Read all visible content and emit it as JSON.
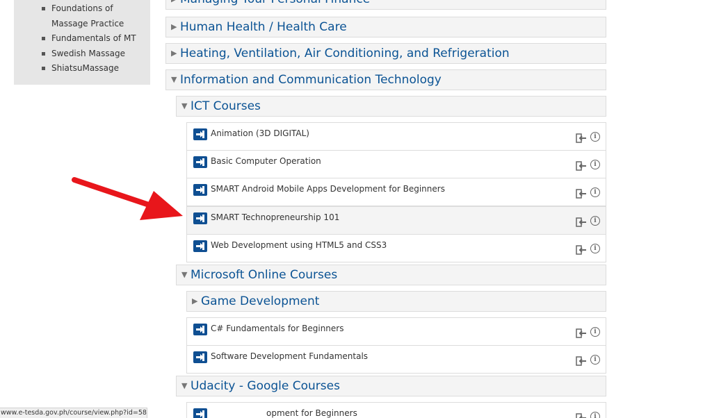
{
  "sidebar": {
    "items": [
      "Foundations of Massage Practice",
      "Fundamentals of MT",
      "Swedish Massage",
      "ShiatsuMassage"
    ]
  },
  "categories": {
    "managing_finance": "Managing Your Personal Finance",
    "human_health": "Human Health / Health Care",
    "hvac": "Heating, Ventilation, Air Conditioning, and Refrigeration",
    "ict": "Information and Communication Technology",
    "ict_courses": "ICT Courses",
    "microsoft": "Microsoft Online Courses",
    "game_dev": "Game Development",
    "udacity": "Udacity - Google Courses"
  },
  "courses": {
    "animation": "Animation (3D DIGITAL)",
    "basic_computer": "Basic Computer Operation",
    "android": "SMART Android Mobile Apps Development for Beginners",
    "technopreneurship": "SMART Technopreneurship 101",
    "web_dev": "Web Development using HTML5 and CSS3",
    "csharp": "C# Fundamentals for Beginners",
    "software_dev": "Software Development Fundamentals",
    "partial": "opment for Beginners"
  },
  "status_bar": {
    "url": "www.e-tesda.gov.ph/course/view.php?id=58"
  },
  "colors": {
    "link": "#0b5394",
    "course_icon": "#0f4f92",
    "arrow": "#e8161b"
  }
}
